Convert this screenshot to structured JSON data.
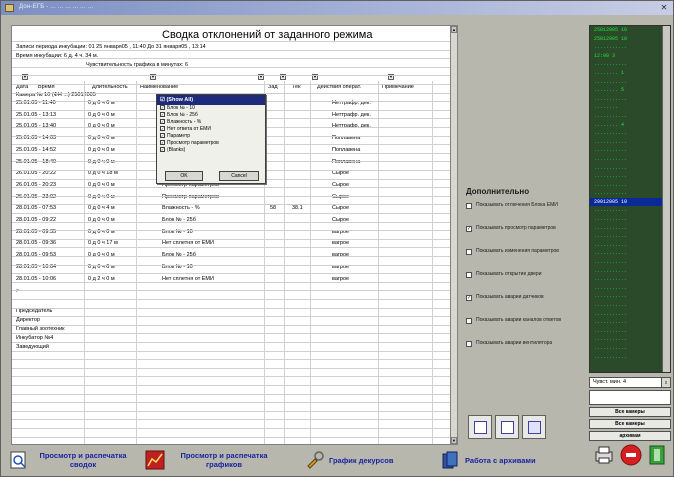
{
  "window": {
    "title": "Дон-ЕГБ - ... ... ... ... ... ..."
  },
  "report": {
    "title": "Сводка отклонений от заданного режима",
    "period_line": "Записи периода инкубации: 01 25 января05 , 11:40  До  31 января05 , 13:14",
    "duration_line": "Время инкубации: 6 д. 4 ч. 34 м.",
    "sensitivity_line": "Чувствительность графика в минутах: 6",
    "columns": [
      "Дата",
      "Время",
      "Длительность",
      "Наименование",
      "Зад",
      "Тек",
      "Действия операт.",
      "Примечание"
    ],
    "chamber_line": "Камера № 10 (ФН ...) 25012005",
    "rows": [
      {
        "date": "25.01.05 - 11:40",
        "dur": "0 д 0 ч 0 м",
        "desc": "",
        "zad": "",
        "tek": "",
        "action": "Неттрафр. дек."
      },
      {
        "date": "25.01.05 - 13:13",
        "dur": "0 д 0 ч 0 м",
        "desc": "",
        "zad": "",
        "tek": "",
        "action": "Неттрафр. дек."
      },
      {
        "date": "25.01.05 - 13:40",
        "dur": "0 д 0 ч 0 м",
        "desc": "",
        "zad": "",
        "tek": "",
        "action": "Неттрафр. дек."
      },
      {
        "date": "25.01.05 - 14:03",
        "dur": "0 д 0 ч 0 м",
        "desc": "",
        "zad": "",
        "tek": "",
        "action": "Поплавена"
      },
      {
        "date": "25.01.05 - 14:52",
        "dur": "0 д 0 ч 0 м",
        "desc": "",
        "zad": "",
        "tek": "",
        "action": "Поплавена"
      },
      {
        "date": "25.01.05 - 18:40",
        "dur": "0 д 0 ч 0 м",
        "desc": "",
        "zad": "",
        "tek": "",
        "action": "Поплавена"
      },
      {
        "date": "26.01.05 - 20:22",
        "dur": "0 д 0 ч 18 м",
        "desc": "Нет сплетня от ЕМИ",
        "zad": "",
        "tek": "",
        "action": "Сырое"
      },
      {
        "date": "26.01.05 - 20:23",
        "dur": "0 д 0 ч 0 м",
        "desc": "Просмотр параметров",
        "zad": "",
        "tek": "",
        "action": "Сырое"
      },
      {
        "date": "26.01.05 - 23:02",
        "dur": "0 д 0 ч 0 м",
        "desc": "Просмотр параметров",
        "zad": "",
        "tek": "",
        "action": "Сырое"
      },
      {
        "date": "28.01.05 - 07:53",
        "dur": "0 д 0 ч 4 м",
        "desc": "Влажность - %",
        "zad": "58",
        "tek": "38.1",
        "action": "Сырое"
      },
      {
        "date": "28.01.05 - 09:22",
        "dur": "0 д 0 ч 0 м",
        "desc": "Блок № - 25б",
        "zad": "",
        "tek": "",
        "action": "Сырое"
      },
      {
        "date": "28.01.05 - 09:35",
        "dur": "0 д 0 ч 0 м",
        "desc": "Блок № - 10",
        "zad": "",
        "tek": "",
        "action": "вагрое"
      },
      {
        "date": "28.01.05 - 09:36",
        "dur": "0 д 0 ч 17 м",
        "desc": "Нет сплетня от ЕМИ",
        "zad": "",
        "tek": "",
        "action": "вагрое"
      },
      {
        "date": "28.01.05 - 09:53",
        "dur": "0 д 0 ч 0 м",
        "desc": "Блок № - 25б",
        "zad": "",
        "tek": "",
        "action": "вагрое"
      },
      {
        "date": "28.01.05 - 10:04",
        "dur": "0 д 0 ч 0 м",
        "desc": "Блок № - 10",
        "zad": "",
        "tek": "",
        "action": "вагрое"
      },
      {
        "date": "28.01.05 - 10:06",
        "dur": "0 д 2 ч 0 м",
        "desc": "Нет сплетня от ЕМИ",
        "zad": "",
        "tek": "",
        "action": "вагрое"
      }
    ],
    "caret": ">",
    "signatures": [
      "Председатель",
      "Директор",
      "Главный зоотехник",
      "Инкубатор №4",
      "Заведующий"
    ]
  },
  "filter_popup": {
    "header": "☑ (Show All)",
    "items": [
      "Блок № - 10",
      "Блок № - 25б",
      "Влажность - %",
      "Нет ответа от ЕМИ",
      "Параметр",
      "Просмотр параметров",
      "(Blanks)"
    ],
    "ok_label": "OK",
    "cancel_label": "Cancel"
  },
  "options": {
    "header": "Дополнительно",
    "items": [
      {
        "label": "Показывать отлючения  Блока ЕМИ",
        "checked": false
      },
      {
        "label": "Показывать просмотр параметров",
        "checked": true
      },
      {
        "label": "Показывать изменения параметров",
        "checked": false
      },
      {
        "label": "Показывать открытие двери",
        "checked": false
      },
      {
        "label": "Показывать аварии датчиков",
        "checked": true
      },
      {
        "label": "Показывать аварии каналов ответов",
        "checked": false
      },
      {
        "label": "Показывать аварии вентилятора",
        "checked": false
      }
    ]
  },
  "green_list": {
    "items": [
      "25012005 10",
      "25012005 10",
      "...........",
      "12:00 3",
      "...........",
      "........ 1",
      "...........",
      "........ 5",
      "...........",
      "........",
      "...........",
      "........ 4",
      "...........",
      "...........",
      "...........",
      "...........",
      "...........",
      "...........",
      "...........",
      "...........",
      "29012005 10",
      "...........",
      "...........",
      "...........",
      "...........",
      "...........",
      "...........",
      "...........",
      "...........",
      "...........",
      "...........",
      "...........",
      "...........",
      "...........",
      "...........",
      "...........",
      "...........",
      "...........",
      "..........."
    ],
    "selected_index": 20
  },
  "spin": {
    "value": "Чувст. мин. 4"
  },
  "right_buttons": [
    "Все камеры",
    "Все камеры",
    "архивам"
  ],
  "bottom": {
    "btn1": "Просмотр и распечатка сводок",
    "btn2": "Просмотр и распечатка графиков",
    "btn3": "График декурсов",
    "btn4": "Работа с архивами"
  },
  "colors": {
    "accent": "#1a24a0",
    "green_text": "#1ee83c",
    "selection": "#0a2a9a"
  }
}
